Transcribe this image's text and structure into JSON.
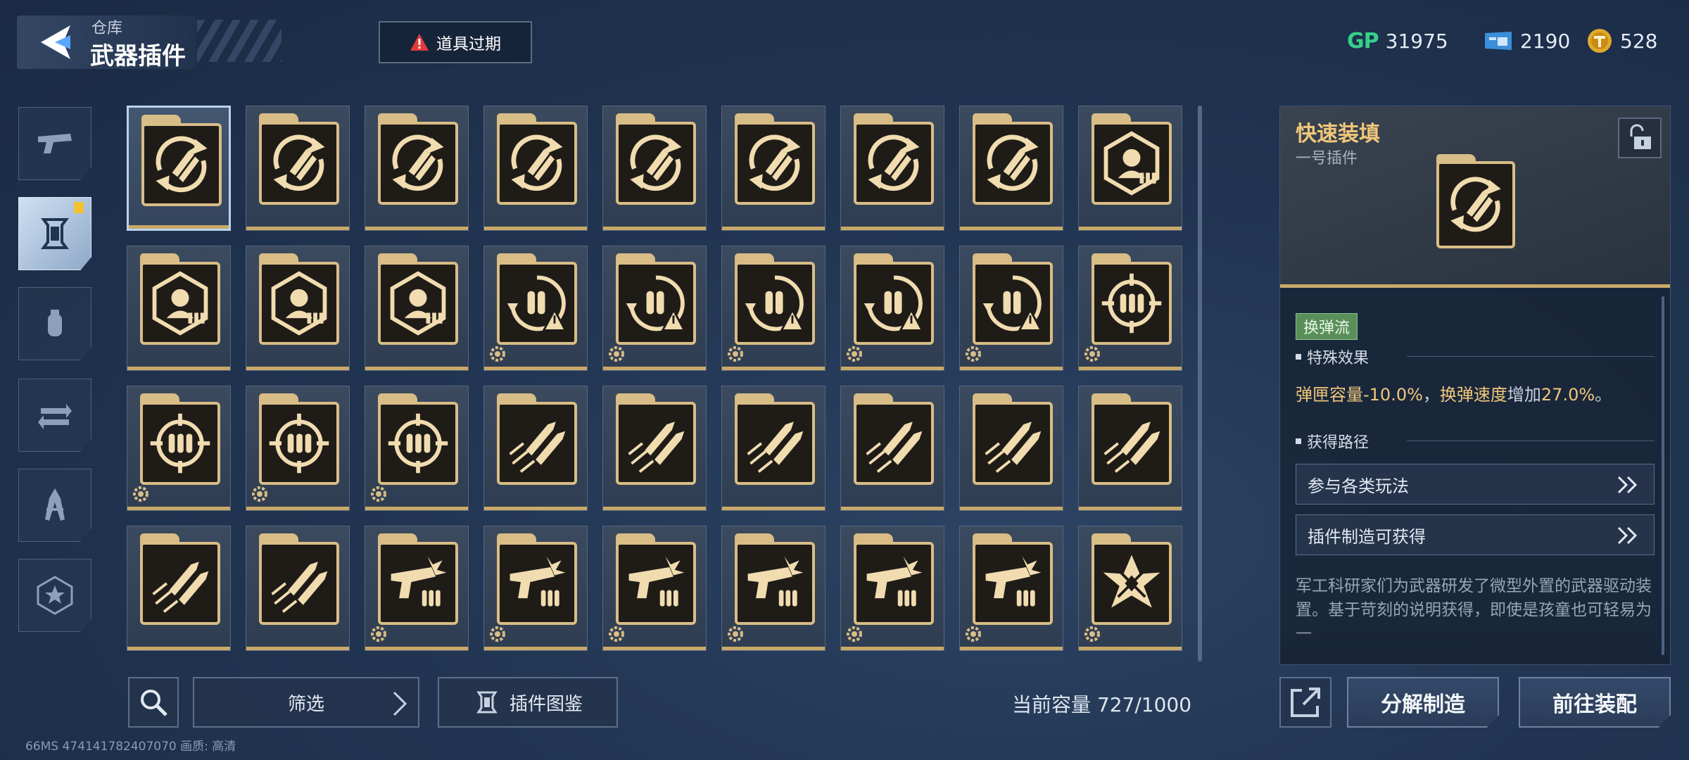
{
  "header": {
    "breadcrumb": "仓库",
    "title": "武器插件",
    "expire_button": "道具过期"
  },
  "currencies": [
    {
      "icon": "gp-icon",
      "label": "GP",
      "value": "31975"
    },
    {
      "icon": "ticket-icon",
      "value": "2190"
    },
    {
      "icon": "coin-icon",
      "value": "528"
    }
  ],
  "sidebar": {
    "items": [
      {
        "name": "pistol-icon",
        "active": false
      },
      {
        "name": "plugin-icon",
        "active": true,
        "badge": true
      },
      {
        "name": "grenade-icon",
        "active": false
      },
      {
        "name": "swap-weapon-icon",
        "active": false
      },
      {
        "name": "tool-icon",
        "active": false
      },
      {
        "name": "star-badge-icon",
        "active": false
      }
    ]
  },
  "grid": {
    "selected_index": 0,
    "items": [
      {
        "icon": "reload-bullets",
        "gear": false
      },
      {
        "icon": "reload-bullets",
        "gear": false
      },
      {
        "icon": "reload-bullets",
        "gear": false
      },
      {
        "icon": "reload-bullets",
        "gear": false
      },
      {
        "icon": "reload-bullets",
        "gear": false
      },
      {
        "icon": "reload-bullets",
        "gear": false
      },
      {
        "icon": "reload-bullets",
        "gear": false
      },
      {
        "icon": "reload-bullets",
        "gear": false
      },
      {
        "icon": "target-head",
        "gear": false
      },
      {
        "icon": "target-head",
        "gear": false
      },
      {
        "icon": "target-head",
        "gear": false
      },
      {
        "icon": "target-head",
        "gear": false
      },
      {
        "icon": "bullets-warning",
        "gear": true
      },
      {
        "icon": "bullets-warning",
        "gear": true
      },
      {
        "icon": "bullets-warning",
        "gear": true
      },
      {
        "icon": "bullets-warning",
        "gear": true
      },
      {
        "icon": "bullets-warning",
        "gear": true
      },
      {
        "icon": "crosshair-bullets",
        "gear": true
      },
      {
        "icon": "crosshair-bullets",
        "gear": true
      },
      {
        "icon": "crosshair-bullets",
        "gear": true
      },
      {
        "icon": "crosshair-bullets",
        "gear": true
      },
      {
        "icon": "speed-bullets",
        "gear": false
      },
      {
        "icon": "speed-bullets",
        "gear": false
      },
      {
        "icon": "speed-bullets",
        "gear": false
      },
      {
        "icon": "speed-bullets",
        "gear": false
      },
      {
        "icon": "speed-bullets",
        "gear": false
      },
      {
        "icon": "speed-bullets",
        "gear": false
      },
      {
        "icon": "speed-bullets",
        "gear": false
      },
      {
        "icon": "speed-bullets",
        "gear": false
      },
      {
        "icon": "gun-bullets",
        "gear": true
      },
      {
        "icon": "gun-bullets",
        "gear": true
      },
      {
        "icon": "gun-bullets",
        "gear": true
      },
      {
        "icon": "gun-bullets",
        "gear": true
      },
      {
        "icon": "gun-bullets",
        "gear": true
      },
      {
        "icon": "gun-bullets",
        "gear": true
      },
      {
        "icon": "burst-emblem",
        "gear": true
      }
    ]
  },
  "bottom": {
    "filter_label": "筛选",
    "catalog_label": "插件图鉴",
    "capacity_label": "当前容量 727/1000",
    "disassemble_label": "分解制造",
    "goto_equip_label": "前往装配",
    "debug_text": "66MS   474141782407070      画质:  高清"
  },
  "detail": {
    "title": "快速装填",
    "subtitle": "一号插件",
    "tag": "换弹流",
    "effect_header": "特殊效果",
    "effect": {
      "part1": "弹匣容量",
      "val1": "-10.0%",
      "sep": "，",
      "part2": "换弹速度",
      "part3": "增加",
      "val2": "27.0%",
      "end": "。"
    },
    "source_header": "获得路径",
    "sources": [
      "参与各类玩法",
      "插件制造可获得"
    ],
    "description": "军工科研家们为武器研发了微型外置的武器驱动装置。基于苛刻的说明获得，即使是孩童也可轻易为一"
  },
  "colors": {
    "accent_gold": "#f0c77a",
    "card_border": "#d8bd86",
    "tag_green": "#5a8f5a",
    "warning_red": "#e23a3a",
    "gp_green": "#35d08a"
  }
}
